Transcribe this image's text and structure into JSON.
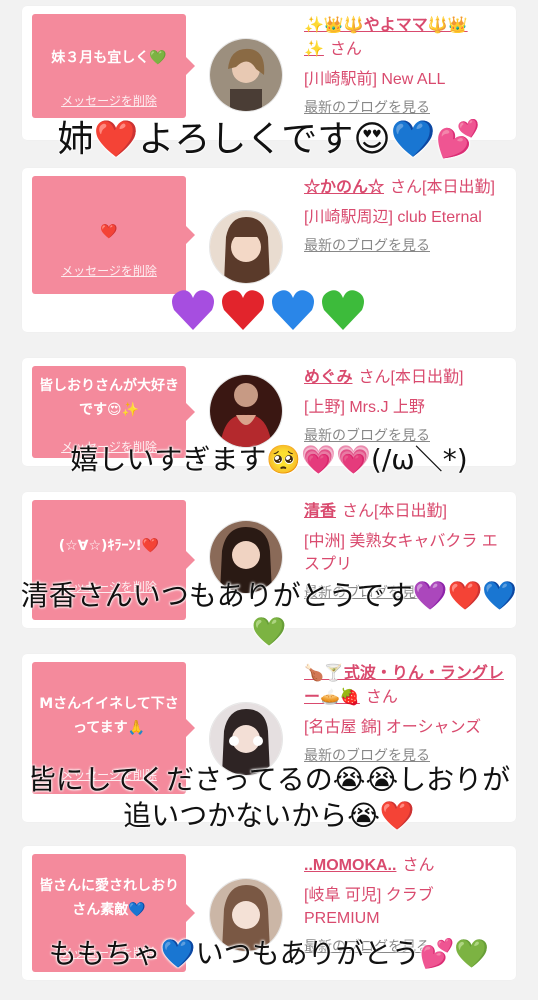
{
  "common": {
    "delete_label": "メッセージを削除",
    "blog_label": "最新のブログを見る",
    "san": "さん"
  },
  "cards": [
    {
      "message": "妹３月も宜しく💚",
      "name": "✨👑🔱やよママ🔱👑\n✨",
      "name_suffix": "",
      "shop": "[川崎駅前] New ALL"
    },
    {
      "message": "❤️",
      "name": "☆かのん☆",
      "name_suffix": "[本日出勤]",
      "shop": "[川崎駅周辺] club Eternal"
    },
    {
      "message": "皆しおりさんが大好きです😍✨",
      "name": "めぐみ",
      "name_suffix": "[本日出勤]",
      "shop": "[上野] Mrs.J 上野"
    },
    {
      "message": "(☆∀☆)ｷﾗｰﾝ!❤️",
      "name": "清香",
      "name_suffix": "[本日出勤]",
      "shop": "[中洲] 美熟女キャバクラ エスプリ"
    },
    {
      "message": "Mさんイイネして下さってます🙏",
      "name": "🍗🍸式波・りん・ラングレー🥧🍓",
      "name_suffix": "",
      "shop": "[名古屋 錦] オーシャンズ"
    },
    {
      "message": "皆さんに愛されしおりさん素敵💙",
      "name": "..MOMOKA..",
      "name_suffix": "",
      "shop": "[岐阜 可児] クラブ PREMIUM"
    }
  ],
  "overlays": [
    "姉❤️よろしくです😍💙💕",
    "嬉しいすぎます🥺💗💗(/ω＼*)",
    "清香さんいつもありがとうです💜❤️💙\n💚",
    "皆にしてくださってるの😭😭しおりが\n追いつかないから😭❤️",
    "ももちゃ💙いつもありがとう💕💚"
  ],
  "colors": {
    "bubble": "#f48a9c",
    "name": "#d94a6e",
    "background": "#f2f2f2"
  }
}
